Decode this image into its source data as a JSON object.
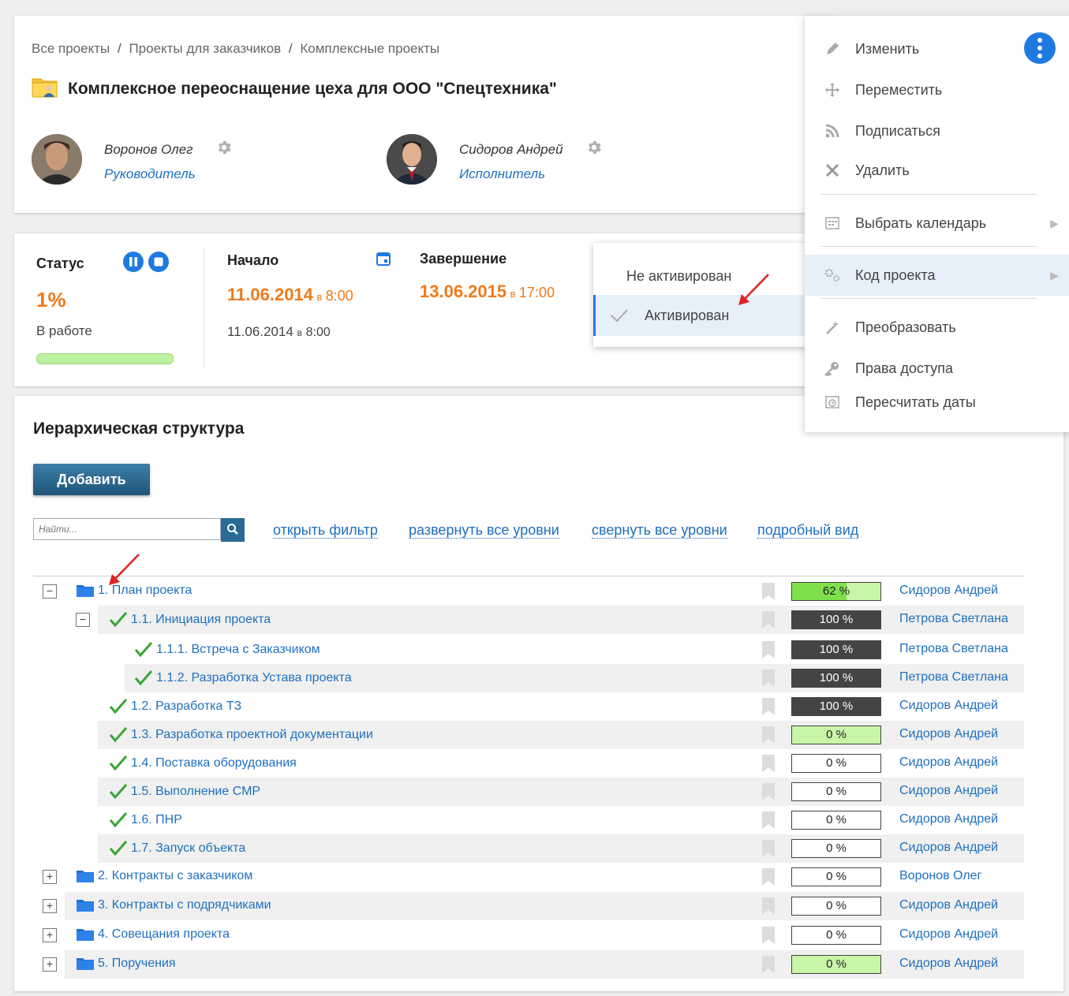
{
  "breadcrumb": [
    "Все проекты",
    "Проекты для заказчиков",
    "Комплексные проекты"
  ],
  "breadcrumb_sep": "/",
  "project": {
    "title": "Комплексное переоснащение цеха для ООО \"Спецтехника\""
  },
  "people": [
    {
      "name": "Воронов Олег",
      "role": "Руководитель"
    },
    {
      "name": "Сидоров Андрей",
      "role": "Исполнитель"
    }
  ],
  "status": {
    "label": "Статус",
    "percent": "1%",
    "state": "В работе",
    "progress": 0.01
  },
  "start": {
    "label": "Начало",
    "date": "11.06.2014",
    "at": "в",
    "time": "8:00",
    "actual_date": "11.06.2014",
    "actual_time": "8:00"
  },
  "finish": {
    "label": "Завершение",
    "date": "13.06.2015",
    "at": "в",
    "time": "17:00"
  },
  "activation": {
    "options": [
      "Не активирован",
      "Активирован"
    ],
    "selected": "Активирован"
  },
  "menu": {
    "items": [
      {
        "label": "Изменить",
        "icon": "pencil-icon"
      },
      {
        "label": "Переместить",
        "icon": "move-icon"
      },
      {
        "label": "Подписаться",
        "icon": "rss-icon"
      },
      {
        "label": "Удалить",
        "icon": "close-icon"
      },
      {
        "label": "Выбрать календарь",
        "icon": "calendar-icon"
      },
      {
        "label": "Код проекта",
        "icon": "gears-icon"
      },
      {
        "label": "Преобразовать",
        "icon": "magic-wand-icon"
      },
      {
        "label": "Права доступа",
        "icon": "key-icon"
      },
      {
        "label": "Пересчитать даты",
        "icon": "calendar-clock-icon"
      }
    ]
  },
  "tree": {
    "title": "Иерархическая структура",
    "add_label": "Добавить",
    "search_placeholder": "Найти...",
    "links": [
      "открыть фильтр",
      "развернуть все уровни",
      "свернуть все уровни",
      "подробный вид"
    ],
    "rows": [
      {
        "label": "1. План проекта",
        "type": "folder",
        "level": 0,
        "toggle": "−",
        "pct": "62 %",
        "pct_value": 0.62,
        "style": "partial",
        "assignee": "Сидоров Андрей",
        "bg": false
      },
      {
        "label": "1.1. Инициация проекта",
        "type": "task",
        "level": 1,
        "toggle": "−",
        "pct": "100 %",
        "pct_value": 1,
        "style": "dark",
        "assignee": "Петрова Светлана",
        "bg": true
      },
      {
        "label": "1.1.1. Встреча с Заказчиком",
        "type": "task",
        "level": 2,
        "toggle": "",
        "pct": "100 %",
        "pct_value": 1,
        "style": "dark",
        "assignee": "Петрова Светлана",
        "bg": false
      },
      {
        "label": "1.1.2. Разработка Устава проекта",
        "type": "task",
        "level": 2,
        "toggle": "",
        "pct": "100 %",
        "pct_value": 1,
        "style": "dark",
        "assignee": "Петрова Светлана",
        "bg": true
      },
      {
        "label": "1.2. Разработка ТЗ",
        "type": "task",
        "level": 1,
        "toggle": "",
        "pct": "100 %",
        "pct_value": 1,
        "style": "dark",
        "assignee": "Сидоров Андрей",
        "bg": false
      },
      {
        "label": "1.3. Разработка проектной документации",
        "type": "task",
        "level": 1,
        "toggle": "",
        "pct": "0 %",
        "pct_value": 0,
        "style": "green",
        "assignee": "Сидоров Андрей",
        "bg": true
      },
      {
        "label": "1.4. Поставка оборудования",
        "type": "task",
        "level": 1,
        "toggle": "",
        "pct": "0 %",
        "pct_value": 0,
        "style": "plain",
        "assignee": "Сидоров Андрей",
        "bg": false
      },
      {
        "label": "1.5. Выполнение СМР",
        "type": "task",
        "level": 1,
        "toggle": "",
        "pct": "0 %",
        "pct_value": 0,
        "style": "plain",
        "assignee": "Сидоров Андрей",
        "bg": true
      },
      {
        "label": "1.6. ПНР",
        "type": "task",
        "level": 1,
        "toggle": "",
        "pct": "0 %",
        "pct_value": 0,
        "style": "plain",
        "assignee": "Сидоров Андрей",
        "bg": false
      },
      {
        "label": "1.7. Запуск объекта",
        "type": "task",
        "level": 1,
        "toggle": "",
        "pct": "0 %",
        "pct_value": 0,
        "style": "plain",
        "assignee": "Сидоров Андрей",
        "bg": true
      },
      {
        "label": "2. Контракты с заказчиком",
        "type": "folder",
        "level": 0,
        "toggle": "+",
        "pct": "0 %",
        "pct_value": 0,
        "style": "plain",
        "assignee": "Воронов Олег",
        "bg": false
      },
      {
        "label": "3. Контракты с подрядчиками",
        "type": "folder",
        "level": 0,
        "toggle": "+",
        "pct": "0 %",
        "pct_value": 0,
        "style": "plain",
        "assignee": "Сидоров Андрей",
        "bg": true
      },
      {
        "label": "4. Совещания проекта",
        "type": "folder",
        "level": 0,
        "toggle": "+",
        "pct": "0 %",
        "pct_value": 0,
        "style": "plain",
        "assignee": "Сидоров Андрей",
        "bg": false
      },
      {
        "label": "5. Поручения",
        "type": "folder",
        "level": 0,
        "toggle": "+",
        "pct": "0 %",
        "pct_value": 0,
        "style": "green",
        "assignee": "Сидоров Андрей",
        "bg": true
      }
    ]
  },
  "colors": {
    "accent": "#1f7ae0",
    "link": "#1f6fbf",
    "orange": "#f07a1a",
    "progress_green": "#7ee04a"
  }
}
